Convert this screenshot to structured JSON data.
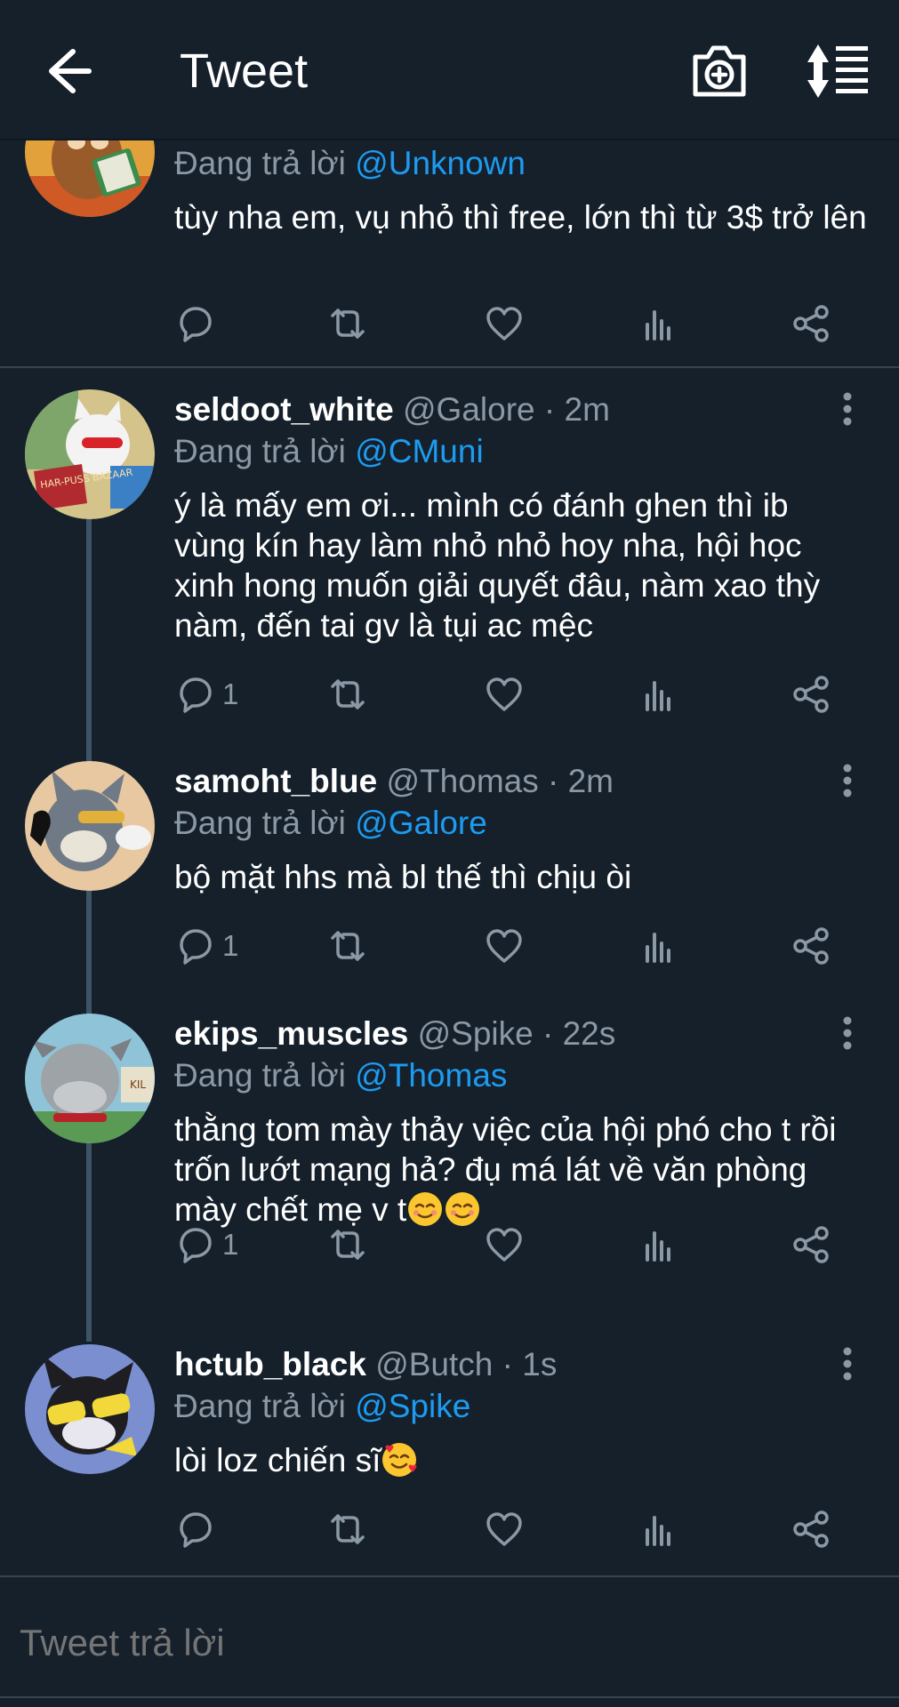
{
  "header": {
    "title": "Tweet",
    "back_icon": "arrow-left-icon",
    "camera_icon": "camera-add-icon",
    "sort_icon": "sort-list-icon"
  },
  "colors": {
    "background": "#15202b",
    "mention": "#1d9bf0",
    "muted": "#8b98a5",
    "divider": "#38444d"
  },
  "tweets": [
    {
      "reply_prefix": "Đang trả lời",
      "reply_to": "@Unknown",
      "text": "tùy nha em, vụ nhỏ thì free, lớn thì từ 3$ trở lên",
      "reply_count": "",
      "avatar": "jerry-mouse-reading-avatar"
    },
    {
      "name": "seldoot_white",
      "handle": "@Galore",
      "time": "· 2m",
      "reply_prefix": "Đang trả lời",
      "reply_to": "@CMuni",
      "text": "ý là mấy em ơi... mình có đánh ghen thì ib vùng kín hay làm nhỏ nhỏ hoy nha, hội học xinh hong muốn giải quyết đâu, nàm xao thỳ nàm, đến tai gv là tụi ac mệc",
      "reply_count": "1",
      "avatar": "white-cat-harpuss-bazaar-avatar",
      "avatar_label": "HAR-PUSS BAZAAR"
    },
    {
      "name": "samoht_blue",
      "handle": "@Thomas",
      "time": "· 2m",
      "reply_prefix": "Đang trả lời",
      "reply_to": "@Galore",
      "text": "bộ mặt hhs mà bl thế thì chịu òi",
      "reply_count": "1",
      "avatar": "tom-cat-on-phone-avatar"
    },
    {
      "name": "ekips_muscles",
      "handle": "@Spike",
      "time": "· 22s",
      "reply_prefix": "Đang trả lời",
      "reply_to": "@Thomas",
      "text": "thằng tom mày thảy việc của hội phó cho t rồi trốn lướt mạng hả? đụ má lát về văn phòng mày chết mẹ v t",
      "text_emoji": "smiling-face-emoji",
      "reply_count": "1",
      "avatar": "spike-bulldog-avatar",
      "avatar_label": "KIL"
    },
    {
      "name": "hctub_black",
      "handle": "@Butch",
      "time": "· 1s",
      "reply_prefix": "Đang trả lời",
      "reply_to": "@Spike",
      "text": "lòi loz chiến sĩ",
      "text_emoji": "smiling-face-with-hearts-emoji",
      "reply_count": "",
      "avatar": "butch-cat-sunglasses-avatar"
    }
  ],
  "actions": {
    "reply_icon": "reply-bubble-icon",
    "retweet_icon": "retweet-icon",
    "like_icon": "heart-icon",
    "stats_icon": "analytics-bars-icon",
    "share_icon": "share-icon"
  },
  "reply_bar": {
    "placeholder": "Tweet trả lời"
  }
}
